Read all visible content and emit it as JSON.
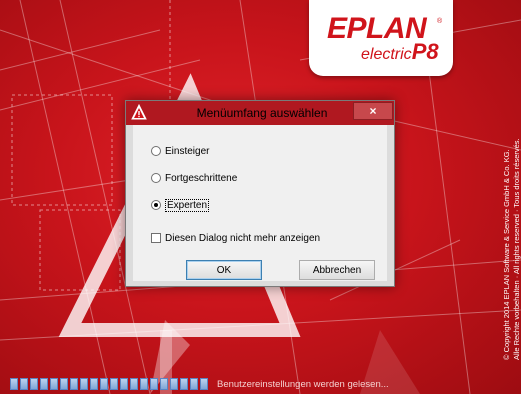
{
  "splash": {
    "logo_brand": "EPLAN",
    "logo_registered": "®",
    "logo_product": "electric",
    "logo_version": "P8",
    "copyright_line1": "© Copyright 2014 EPLAN Software & Service GmbH & Co. KG.",
    "copyright_line2": "Alle Rechte vorbehalten · All rights reserved · Tous droits réservés.",
    "status_text": "Benutzereinstellungen werden gelesen...",
    "progress_segments": 20,
    "colors": {
      "background_red": "#c8141b",
      "progress_blue": "#7fa6d6",
      "logo_red": "#d0141b"
    }
  },
  "dialog": {
    "title": "Menüumfang auswählen",
    "close_label": "×",
    "title_icon": "warning-triangle-icon",
    "options": [
      {
        "label": "Einsteiger",
        "checked": false
      },
      {
        "label": "Fortgeschrittene",
        "checked": false
      },
      {
        "label": "Experten",
        "checked": true
      }
    ],
    "checkbox_label": "Diesen Dialog nicht mehr anzeigen",
    "checkbox_checked": false,
    "ok_label": "OK",
    "cancel_label": "Abbrechen"
  }
}
